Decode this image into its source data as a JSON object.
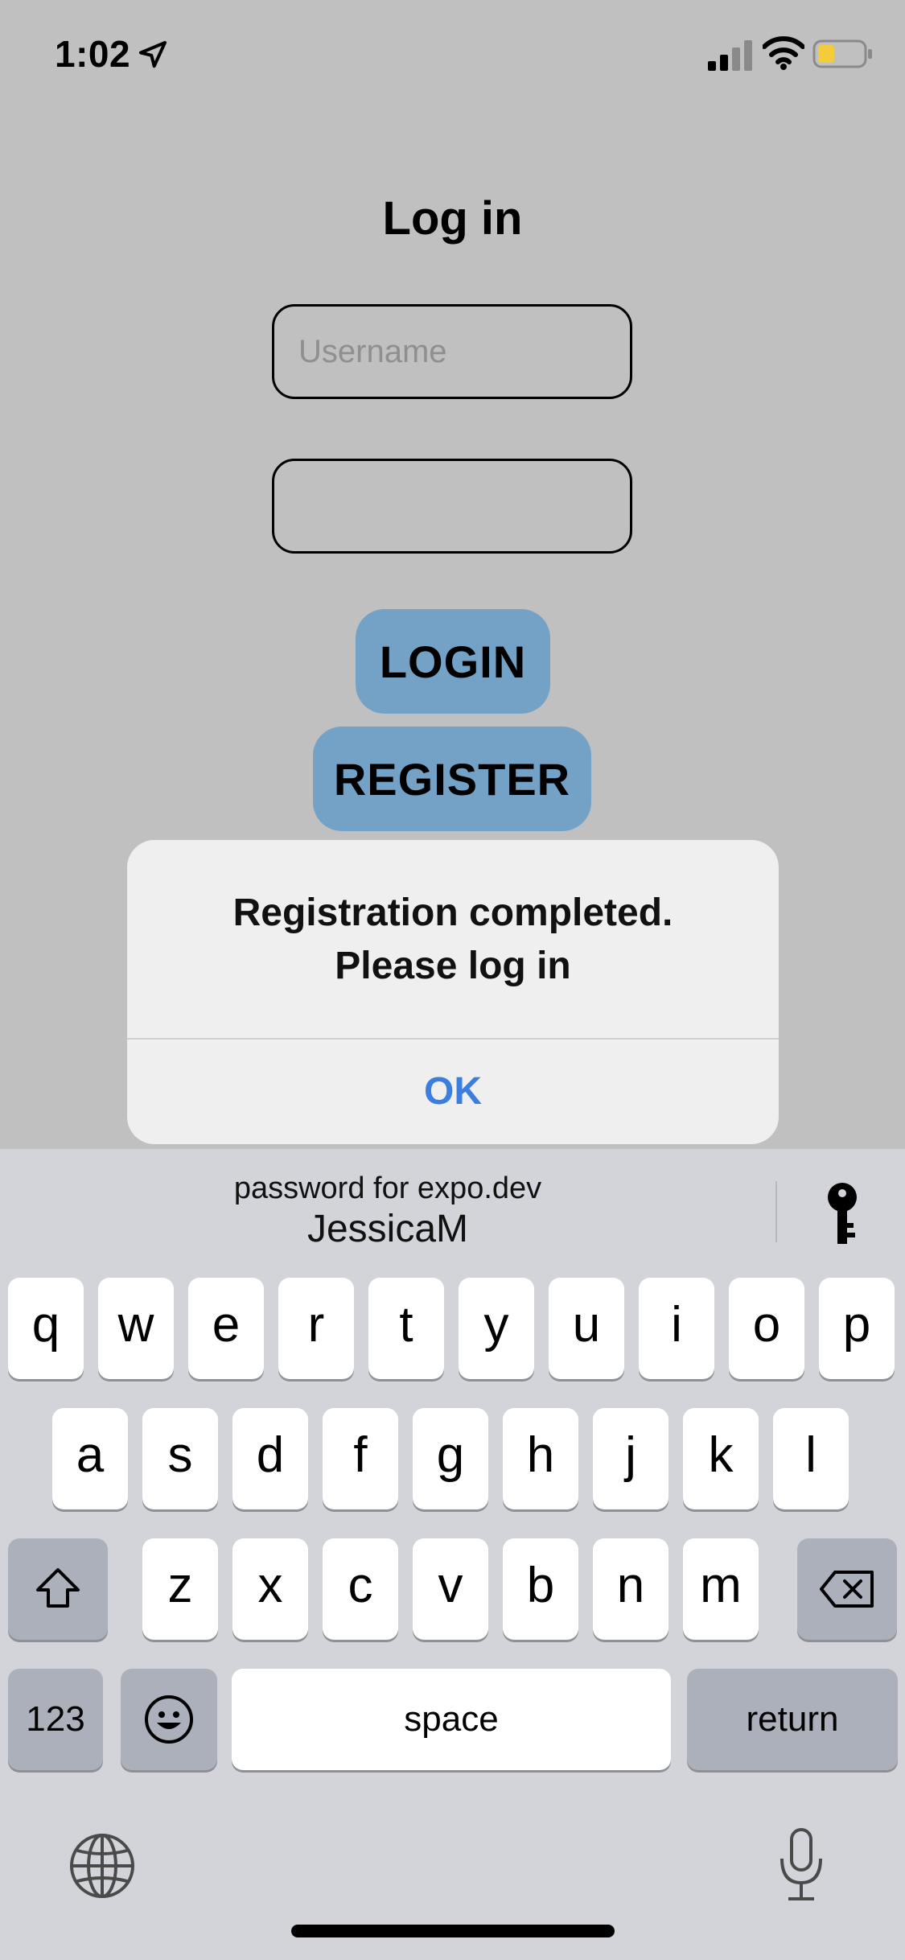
{
  "status_bar": {
    "time": "1:02"
  },
  "screen": {
    "title": "Log in",
    "username_placeholder": "Username",
    "password_value": "",
    "login_label": "LOGIN",
    "register_label": "REGISTER"
  },
  "alert": {
    "message_line1": "Registration completed.",
    "message_line2": "Please log in",
    "ok_label": "OK"
  },
  "keyboard": {
    "suggestion_subtitle": "password for expo.dev",
    "suggestion_title": "JessicaM",
    "row1": [
      "q",
      "w",
      "e",
      "r",
      "t",
      "y",
      "u",
      "i",
      "o",
      "p"
    ],
    "row2": [
      "a",
      "s",
      "d",
      "f",
      "g",
      "h",
      "j",
      "k",
      "l"
    ],
    "row3": [
      "z",
      "x",
      "c",
      "v",
      "b",
      "n",
      "m"
    ],
    "numbers_label": "123",
    "space_label": "space",
    "return_label": "return"
  },
  "colors": {
    "background": "#c0c0c0",
    "button": "#74a2c6",
    "alert_action": "#3c7de0",
    "keyboard": "#d2d4d9",
    "battery_fill": "#f4cb39"
  }
}
